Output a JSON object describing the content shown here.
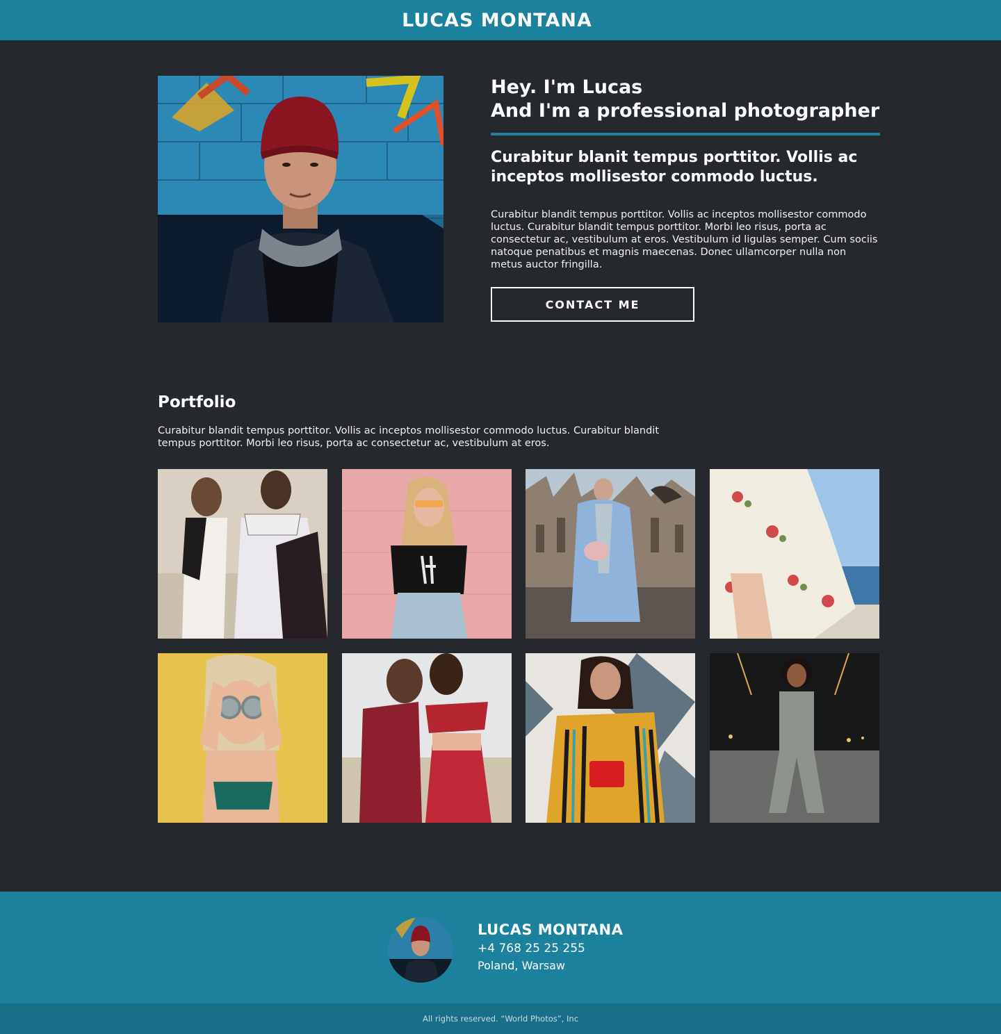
{
  "header": {
    "title": "LUCAS MONTANA"
  },
  "hero": {
    "photo": "portrait-photo",
    "heading_line1": "Hey. I'm Lucas",
    "heading_line2": "And I'm a professional photographer",
    "subheading": "Curabitur blanit tempus porttitor. Vollis ac inceptos mollisestor commodo luctus.",
    "paragraph": "Curabitur blandit tempus porttitor. Vollis ac inceptos mollisestor commodo luctus. Curabitur blandit tempus porttitor. Morbi leo risus, porta ac consectetur ac, vestibulum at eros. Vestibulum id ligulas semper. Cum sociis natoque penatibus et magnis maecenas. Donec ullamcorper nulla non metus auctor fringilla.",
    "button_label": "CONTACT ME"
  },
  "portfolio": {
    "title": "Portfolio",
    "description": "Curabitur blandit tempus porttitor. Vollis ac inceptos mollisestor commodo luctus. Curabitur blandit tempus porttitor. Morbi leo risus, porta ac consectetur ac, vestibulum at eros.",
    "images": [
      "portfolio-photo-1",
      "portfolio-photo-2",
      "portfolio-photo-3",
      "portfolio-photo-4",
      "portfolio-photo-5",
      "portfolio-photo-6",
      "portfolio-photo-7",
      "portfolio-photo-8"
    ]
  },
  "footer": {
    "name": "LUCAS MONTANA",
    "phone": "+4 768 25 25 255",
    "location": "Poland, Warsaw",
    "copyright": "All rights reserved. “World Photos”, Inc"
  },
  "colors": {
    "accent": "#1b819c",
    "background": "#25282d",
    "bottom_bar": "#196f88"
  }
}
